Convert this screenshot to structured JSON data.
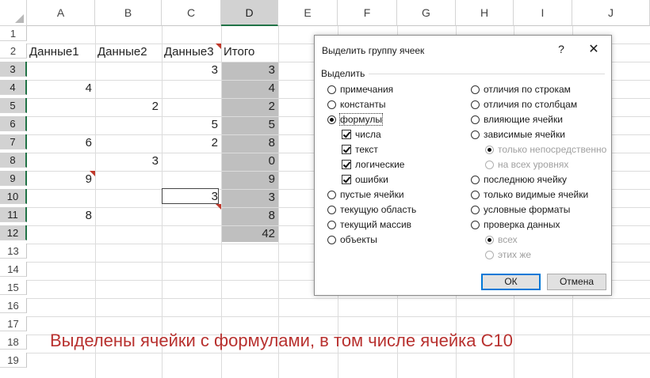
{
  "sheet": {
    "columns": [
      "A",
      "B",
      "C",
      "D",
      "E",
      "F",
      "G",
      "H",
      "I",
      "J"
    ],
    "rows": [
      "1",
      "2",
      "3",
      "4",
      "5",
      "6",
      "7",
      "8",
      "9",
      "10",
      "11",
      "12",
      "13",
      "14",
      "15",
      "16",
      "17",
      "18",
      "19"
    ],
    "headers": {
      "a2": "Данные1",
      "b2": "Данные2",
      "c2": "Данные3",
      "d2": "Итого"
    },
    "values": {
      "c3": "3",
      "d3": "3",
      "a4": "4",
      "d4": "4",
      "b5": "2",
      "d5": "2",
      "c6": "5",
      "d6": "5",
      "a7": "6",
      "c7": "2",
      "d7": "8",
      "b8": "3",
      "d8": "0",
      "a9": "9",
      "d9": "9",
      "c10": "3",
      "d10": "3",
      "a11": "8",
      "d11": "8",
      "d12": "42"
    },
    "selection_color": "#bfbfbf",
    "comment_marker_color": "#c0392b"
  },
  "dialog": {
    "title": "Выделить группу ячеек",
    "help": "?",
    "close": "✕",
    "group_label": "Выделить",
    "left_options": {
      "comments": "примечания",
      "constants": "константы",
      "formulas": "формулы",
      "numbers": "числа",
      "text": "текст",
      "logicals": "логические",
      "errors": "ошибки",
      "blanks": "пустые ячейки",
      "current_region": "текущую область",
      "current_array": "текущий массив",
      "objects": "объекты"
    },
    "right_options": {
      "row_differences": "отличия по строкам",
      "column_differences": "отличия по столбцам",
      "precedents": "влияющие ячейки",
      "dependents": "зависимые ячейки",
      "direct_only": "только непосредственно",
      "all_levels": "на всех уровнях",
      "last_cell": "последнюю ячейку",
      "visible_cells": "только видимые ячейки",
      "conditional_formats": "условные форматы",
      "data_validation": "проверка данных",
      "all": "всех",
      "same": "этих же"
    },
    "ok": "ОК",
    "cancel": "Отмена"
  },
  "caption": "Выделены ячейки с формулами, в том числе ячейка С10"
}
